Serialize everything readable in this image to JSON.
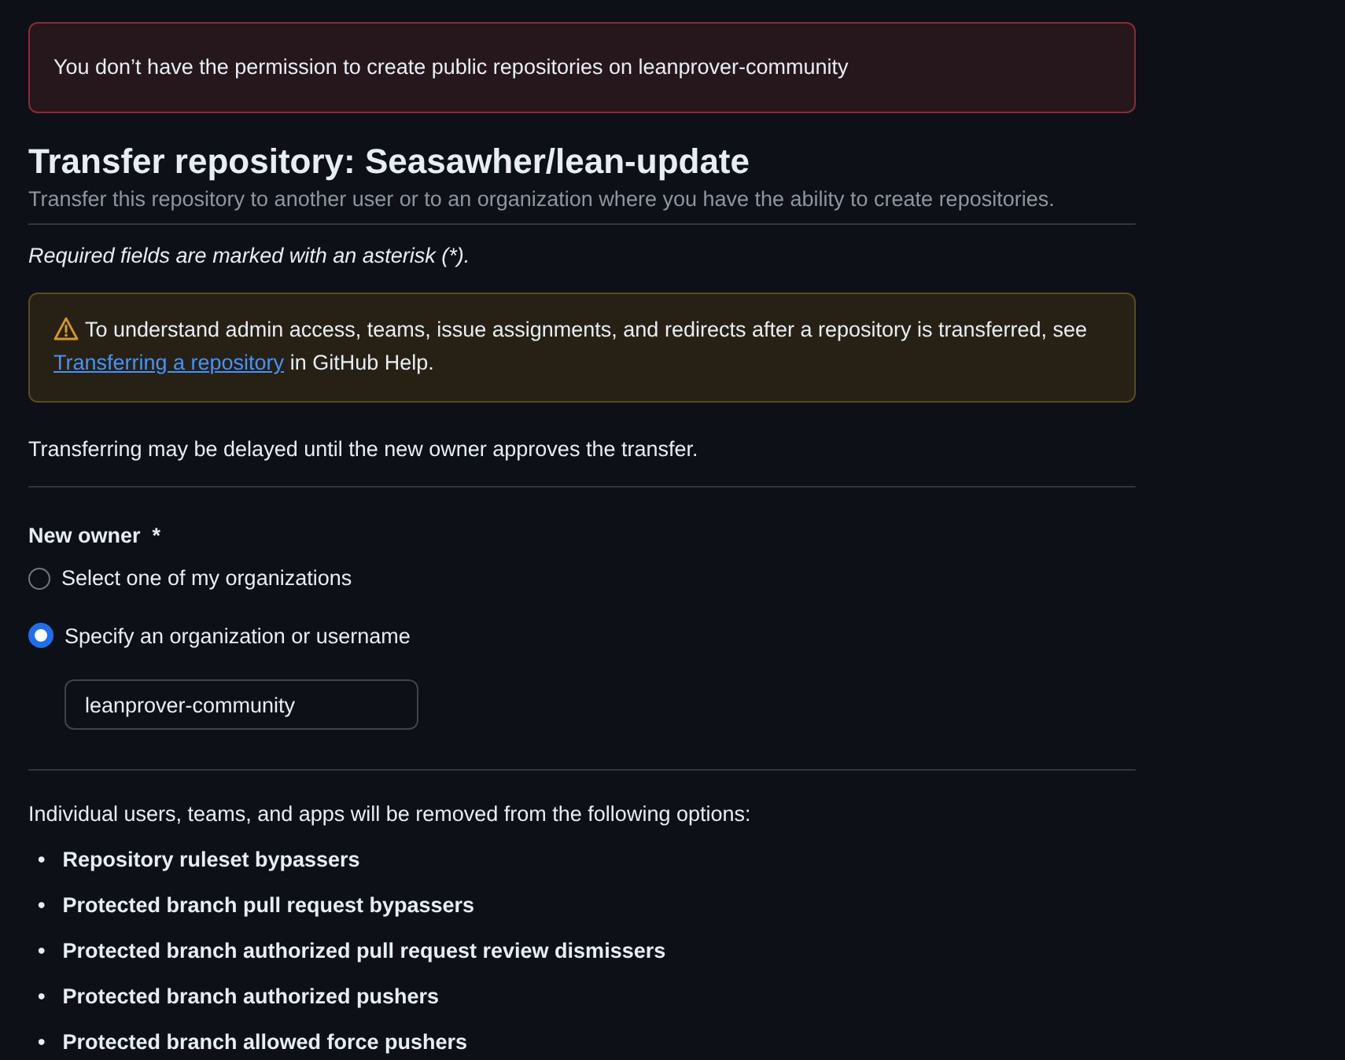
{
  "alert": {
    "kind": "error",
    "text": "You don’t have the permission to create public repositories on leanprover-community"
  },
  "heading": {
    "title": "Transfer repository: Seasawher/lean-update",
    "subtitle": "Transfer this repository to another user or to an organization where you have the ability to create repositories."
  },
  "required_note": "Required fields are marked with an asterisk (*).",
  "notice": {
    "kind": "warning",
    "text_before": "To understand admin access, teams, issue assignments, and redirects after a repository is transferred, see ",
    "link": "Transferring a repository",
    "text_after": " in GitHub Help."
  },
  "delay_note": "Transferring may be delayed until the new owner approves the transfer.",
  "new_owner": {
    "label": "New owner",
    "required_mark": "*",
    "options": [
      {
        "label": "Select one of my organizations",
        "selected": false
      },
      {
        "label": "Specify an organization or username",
        "selected": true
      }
    ],
    "input": {
      "value": "leanprover-community"
    }
  },
  "removal_note": "Individual users, teams, and apps will be removed from the following options:",
  "removal_items": [
    {
      "marker": "•",
      "text": "Repository ruleset bypassers"
    },
    {
      "marker": "•",
      "text": "Protected branch pull request bypassers"
    },
    {
      "marker": "•",
      "text": "Protected branch authorized pull request review dismissers"
    },
    {
      "marker": "•",
      "text": "Protected branch authorized pushers"
    },
    {
      "marker": "•",
      "text": "Protected branch allowed force pushers"
    }
  ]
}
